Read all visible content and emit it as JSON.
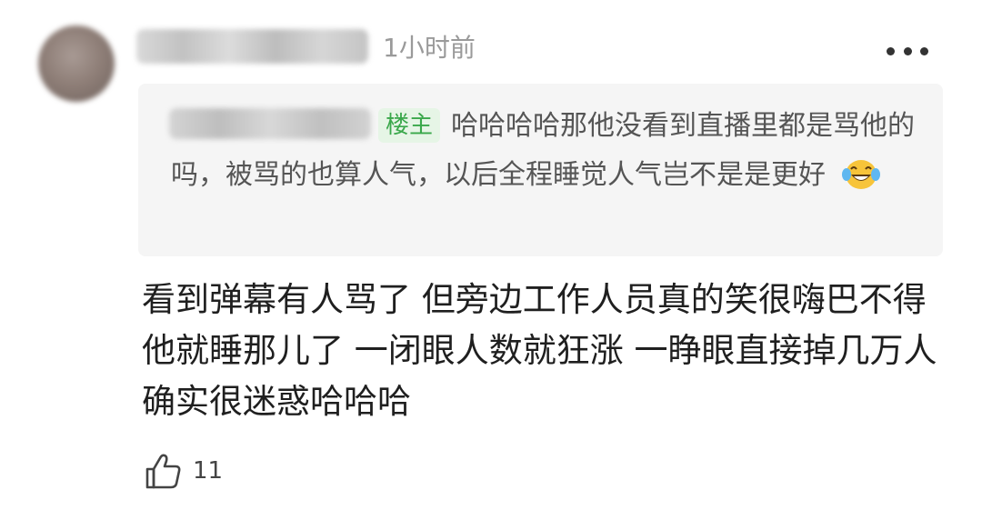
{
  "comment": {
    "time": "1小时前",
    "reply": {
      "badge": "楼主",
      "text": "哈哈哈哈那他没看到直播里都是骂他的吗，被骂的也算人气，以后全程睡觉人气岂不是是更好"
    },
    "body": "看到弹幕有人骂了 但旁边工作人员真的笑很嗨巴不得他就睡那儿了 一闭眼人数就狂涨 一睁眼直接掉几万人 确实很迷惑哈哈哈",
    "like_count": "11",
    "icons": {
      "more": "more-dots-icon",
      "emoji": "laughing-tears-emoji",
      "like": "thumbs-up-icon"
    },
    "colors": {
      "badge_text": "#3aa84b",
      "badge_bg": "#e6f5e6",
      "reply_bg": "#f5f5f5"
    }
  }
}
